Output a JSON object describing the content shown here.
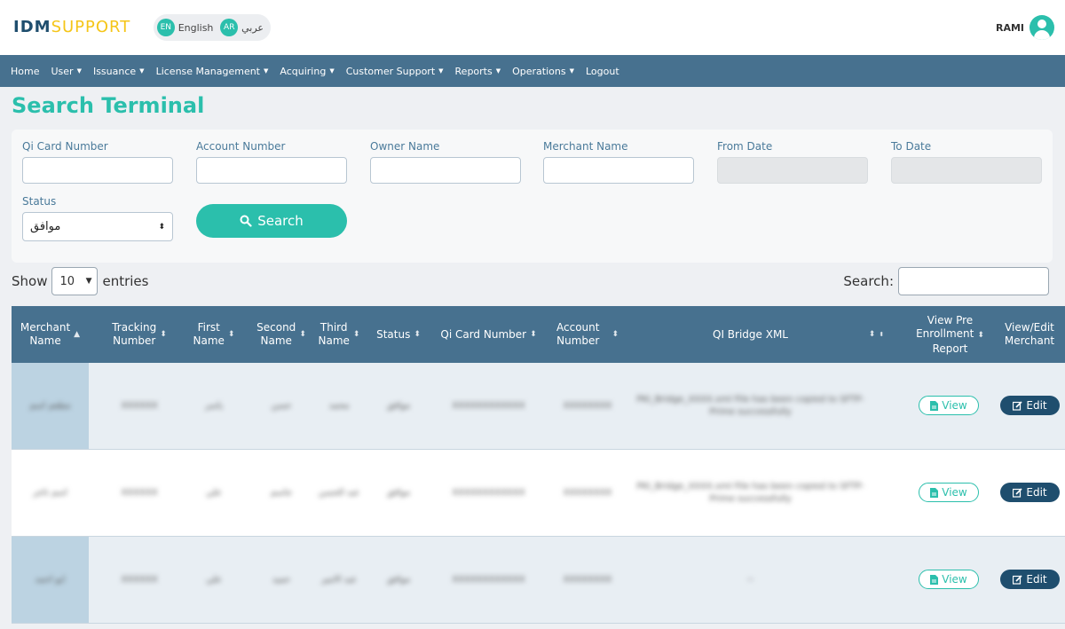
{
  "brand": {
    "part1": "IDM",
    "part2": "SUPPORT"
  },
  "language": {
    "en_chip": "EN",
    "en_label": "English",
    "ar_chip": "AR",
    "ar_label": "عربي"
  },
  "user": {
    "name": "RAMI"
  },
  "nav": [
    {
      "label": "Home",
      "dropdown": false
    },
    {
      "label": "User",
      "dropdown": true
    },
    {
      "label": "Issuance",
      "dropdown": true
    },
    {
      "label": "License Management",
      "dropdown": true
    },
    {
      "label": "Acquiring",
      "dropdown": true
    },
    {
      "label": "Customer Support",
      "dropdown": true
    },
    {
      "label": "Reports",
      "dropdown": true
    },
    {
      "label": "Operations",
      "dropdown": true
    },
    {
      "label": "Logout",
      "dropdown": false
    }
  ],
  "page": {
    "title": "Search Terminal"
  },
  "form": {
    "qi_card_label": "Qi Card Number",
    "account_label": "Account Number",
    "owner_label": "Owner Name",
    "merchant_label": "Merchant Name",
    "from_date_label": "From Date",
    "to_date_label": "To Date",
    "status_label": "Status",
    "status_value": "موافق",
    "search_button": "Search"
  },
  "datatable": {
    "show_label": "Show",
    "entries_label": "entries",
    "page_length": "10",
    "search_label": "Search:"
  },
  "table": {
    "headers": {
      "merchant_name_1": "Merchant",
      "merchant_name_2": "Name",
      "tracking_1": "Tracking",
      "tracking_2": "Number",
      "first_1": "First",
      "first_2": "Name",
      "second_1": "Second",
      "second_2": "Name",
      "third_1": "Third",
      "third_2": "Name",
      "status": "Status",
      "qi_card": "Qi Card Number",
      "account_1": "Account",
      "account_2": "Number",
      "qi_bridge": "QI Bridge XML",
      "view_pre_1": "View Pre",
      "view_pre_2": "Enrollment",
      "view_pre_3": "Report",
      "view_edit_1": "View/Edit",
      "view_edit_2": "Merchant"
    },
    "rows": [
      {
        "merchant": "مطعم اسم",
        "tracking": "XXXXXX",
        "first": "ياسر",
        "second": "حسن",
        "third": "محمد",
        "status": "موافق",
        "qi_card": "XXXXXXXXXXXX",
        "account": "XXXXXXXX",
        "bridge": "PKI_Bridge_XXXX.xml File has been copied to SFTP-Prime successfully",
        "view": "View",
        "edit": "Edit"
      },
      {
        "merchant": "اسم تاجر",
        "tracking": "XXXXXX",
        "first": "علي",
        "second": "جاسم",
        "third": "عبد الحسن",
        "status": "موافق",
        "qi_card": "XXXXXXXXXXXX",
        "account": "XXXXXXXX",
        "bridge": "PKI_Bridge_XXXX.xml File has been copied to SFTP-Prime successfully",
        "view": "View",
        "edit": "Edit"
      },
      {
        "merchant": "ابو احمد",
        "tracking": "XXXXXX",
        "first": "علي",
        "second": "حميد",
        "third": "عبد الامير",
        "status": "موافق",
        "qi_card": "XXXXXXXXXXXX",
        "account": "XXXXXXXX",
        "bridge": "--",
        "view": "View",
        "edit": "Edit"
      }
    ]
  },
  "colors": {
    "accent": "#2bbfac",
    "nav_bg": "#47718f",
    "dark_button": "#1f4e6e",
    "brand_yellow": "#f5c518"
  }
}
